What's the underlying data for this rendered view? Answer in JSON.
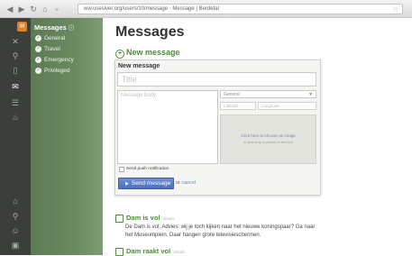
{
  "browser": {
    "url": "ww.usesiver.org/users/10/message  ·  Message | Berdetal",
    "nav_icons": [
      "back-arrow",
      "forward-arrow",
      "reload",
      "home"
    ]
  },
  "rail": {
    "icons": [
      "tools-icon",
      "pin-icon",
      "phone-icon",
      "inbox-icon",
      "list-icon",
      "drop-icon",
      "home-icon",
      "search-icon",
      "users-icon",
      "lock-icon"
    ]
  },
  "sidebar": {
    "title": "Messages",
    "items": [
      {
        "label": "General"
      },
      {
        "label": "Travel"
      },
      {
        "label": "Emergency"
      },
      {
        "label": "Privileged"
      }
    ]
  },
  "main": {
    "title": "Messages",
    "new_message_link": "New message",
    "form": {
      "heading": "New message",
      "title_placeholder": "Title",
      "body_placeholder": "Message body",
      "select_value": "General",
      "lat_placeholder": "Latitude",
      "lon_placeholder": "Longitude",
      "drop_text": "Click here to choose an image",
      "drop_subtext": "or just drop a picture in the box",
      "push_label": "Send push notification",
      "send_label": "Send message",
      "or_text": "or",
      "cancel_label": "cancel"
    },
    "messages": [
      {
        "title": "Dam is vol",
        "meta": "details",
        "body": "De Dam is vol. Advies: wij je toch kijken naar het nieuwe koningspaar? Ga naar het Museumplein. Daar hangen grote televisieschermen."
      },
      {
        "title": "Dam raakt vol",
        "meta": "details",
        "body": ""
      }
    ]
  },
  "colors": {
    "accent_green": "#4f8a3c",
    "sidebar_green": "#6b8a60",
    "rail_dark": "#3c3e3b",
    "button_blue": "#5577c6",
    "logo_orange": "#e67e22"
  }
}
